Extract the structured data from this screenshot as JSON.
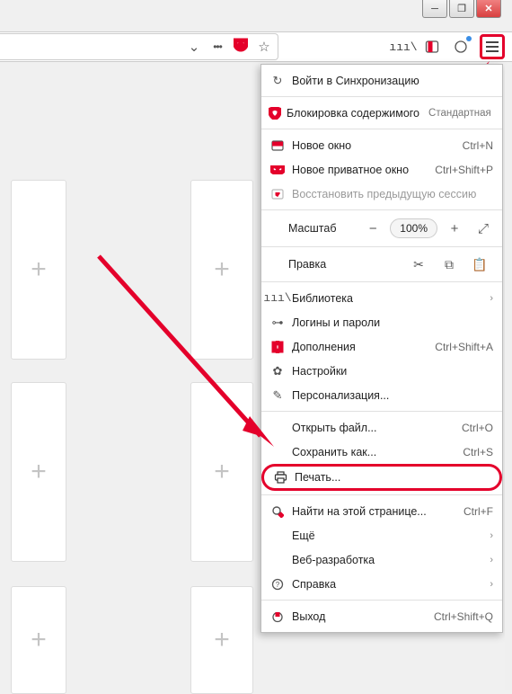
{
  "toolbar": {
    "addr_actions": {
      "dropdown": "⌄",
      "dots": "•••",
      "pocket": "⌄",
      "star": "☆"
    }
  },
  "right_icons": {
    "library": "|||\\",
    "reader": "▣",
    "account": "◐",
    "menu": "≡"
  },
  "menu": {
    "sync": "Войти в Синхронизацию",
    "blocking": "Блокировка содержимого",
    "blocking_badge": "Стандартная",
    "new_window": "Новое окно",
    "new_window_sc": "Ctrl+N",
    "priv_window": "Новое приватное окно",
    "priv_window_sc": "Ctrl+Shift+P",
    "restore": "Восстановить предыдущую сессию",
    "zoom_label": "Масштаб",
    "zoom_pct": "100%",
    "edit_label": "Правка",
    "library": "Библиотека",
    "logins": "Логины и пароли",
    "addons": "Дополнения",
    "addons_sc": "Ctrl+Shift+A",
    "settings": "Настройки",
    "customize": "Персонализация...",
    "open_file": "Открыть файл...",
    "open_file_sc": "Ctrl+O",
    "save_as": "Сохранить как...",
    "save_as_sc": "Ctrl+S",
    "print": "Печать...",
    "find": "Найти на этой странице...",
    "find_sc": "Ctrl+F",
    "more": "Ещё",
    "webdev": "Веб-разработка",
    "help": "Справка",
    "quit": "Выход",
    "quit_sc": "Ctrl+Shift+Q"
  }
}
